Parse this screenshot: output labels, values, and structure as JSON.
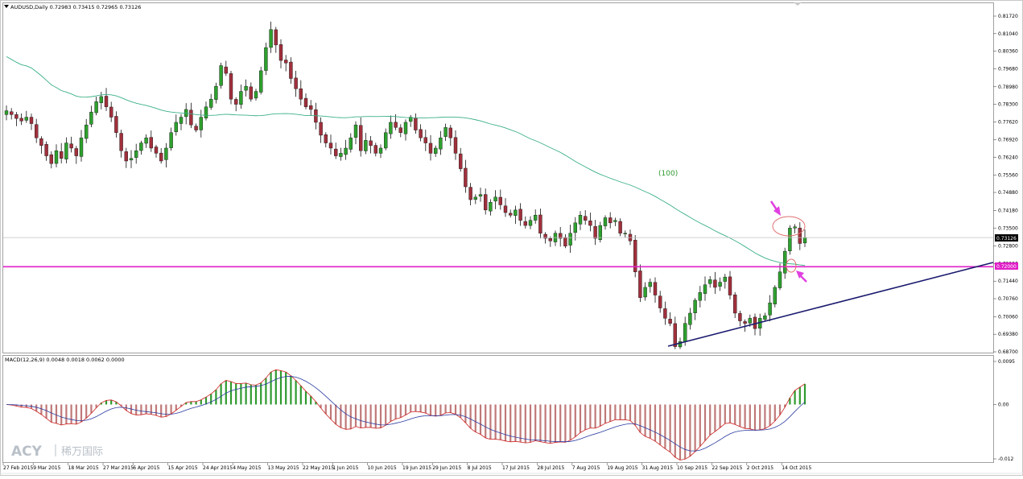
{
  "header": {
    "symbol_line": "AUDUSD,Daily  0.72983 0.73415 0.72965 0.73126",
    "indicator_line": "MACD(12,26,9) 0.0048 0.0018 0.0062 0.0000"
  },
  "labels": {
    "ma_label": "(100)",
    "price_badge": "0.73126",
    "level_badge": "0.72000"
  },
  "watermark": {
    "brand": "ACY",
    "chinese": "稀万国际"
  },
  "colors": {
    "bull": "#2ea02e",
    "bear": "#a0303c",
    "ma": "#3bb085",
    "level": "#e020c8",
    "trend": "#1a1a6e",
    "macd_pos": "#2e9a2e",
    "macd_neg": "#c07878",
    "macd_line": "#2a3aa0",
    "signal_line": "#cc2222",
    "circle": "#e07070",
    "arrow": "#e040e0"
  },
  "chart_data": [
    {
      "type": "candlestick",
      "title": "AUDUSD,Daily",
      "ylim": [
        0.687,
        0.8205
      ],
      "yticks": [
        "0.81720",
        "0.81040",
        "0.80360",
        "0.79680",
        "0.78980",
        "0.78300",
        "0.77620",
        "0.76920",
        "0.76240",
        "0.75560",
        "0.74880",
        "0.74180",
        "0.73500",
        "0.72800",
        "0.72120",
        "0.71440",
        "0.70760",
        "0.70060",
        "0.69380",
        "0.68700"
      ],
      "xticks": [
        {
          "label": "27 Feb 2015",
          "bar": 0
        },
        {
          "label": "9 Mar 2015",
          "bar": 6
        },
        {
          "label": "18 Mar 2015",
          "bar": 13
        },
        {
          "label": "27 Mar 2015",
          "bar": 20
        },
        {
          "label": "6 Apr 2015",
          "bar": 26
        },
        {
          "label": "15 Apr 2015",
          "bar": 33
        },
        {
          "label": "24 Apr 2015",
          "bar": 40
        },
        {
          "label": "4 May 2015",
          "bar": 46
        },
        {
          "label": "13 May 2015",
          "bar": 53
        },
        {
          "label": "22 May 2015",
          "bar": 60
        },
        {
          "label": "1 Jun 2015",
          "bar": 66
        },
        {
          "label": "10 Jun 2015",
          "bar": 73
        },
        {
          "label": "19 Jun 2015",
          "bar": 80
        },
        {
          "label": "29 Jun 2015",
          "bar": 86
        },
        {
          "label": "8 Jul 2015",
          "bar": 93
        },
        {
          "label": "17 Jul 2015",
          "bar": 100
        },
        {
          "label": "28 Jul 2015",
          "bar": 107
        },
        {
          "label": "7 Aug 2015",
          "bar": 114
        },
        {
          "label": "19 Aug 2015",
          "bar": 121
        },
        {
          "label": "31 Aug 2015",
          "bar": 128
        },
        {
          "label": "10 Sep 2015",
          "bar": 135
        },
        {
          "label": "22 Sep 2015",
          "bar": 142
        },
        {
          "label": "2 Oct 2015",
          "bar": 149
        },
        {
          "label": "14 Oct 2015",
          "bar": 156
        }
      ],
      "closes": [
        0.7805,
        0.779,
        0.7775,
        0.7765,
        0.778,
        0.7755,
        0.77,
        0.767,
        0.763,
        0.76,
        0.765,
        0.762,
        0.768,
        0.766,
        0.763,
        0.77,
        0.775,
        0.78,
        0.784,
        0.786,
        0.782,
        0.778,
        0.772,
        0.765,
        0.761,
        0.762,
        0.765,
        0.768,
        0.77,
        0.766,
        0.764,
        0.761,
        0.766,
        0.772,
        0.776,
        0.778,
        0.781,
        0.775,
        0.773,
        0.778,
        0.782,
        0.785,
        0.79,
        0.798,
        0.795,
        0.785,
        0.783,
        0.788,
        0.79,
        0.785,
        0.788,
        0.796,
        0.805,
        0.812,
        0.806,
        0.8,
        0.799,
        0.793,
        0.789,
        0.785,
        0.782,
        0.781,
        0.776,
        0.771,
        0.768,
        0.766,
        0.763,
        0.764,
        0.766,
        0.77,
        0.775,
        0.765,
        0.769,
        0.767,
        0.764,
        0.766,
        0.772,
        0.776,
        0.774,
        0.772,
        0.776,
        0.778,
        0.773,
        0.77,
        0.768,
        0.764,
        0.766,
        0.77,
        0.774,
        0.77,
        0.764,
        0.758,
        0.751,
        0.746,
        0.747,
        0.748,
        0.742,
        0.745,
        0.747,
        0.744,
        0.741,
        0.74,
        0.742,
        0.738,
        0.736,
        0.738,
        0.74,
        0.733,
        0.731,
        0.73,
        0.733,
        0.731,
        0.728,
        0.733,
        0.737,
        0.74,
        0.738,
        0.736,
        0.731,
        0.736,
        0.739,
        0.737,
        0.738,
        0.733,
        0.733,
        0.73,
        0.718,
        0.708,
        0.712,
        0.714,
        0.709,
        0.704,
        0.7,
        0.698,
        0.689,
        0.691,
        0.698,
        0.702,
        0.707,
        0.71,
        0.713,
        0.715,
        0.712,
        0.714,
        0.716,
        0.709,
        0.702,
        0.699,
        0.698,
        0.7,
        0.696,
        0.7,
        0.701,
        0.706,
        0.712,
        0.718,
        0.726,
        0.735,
        0.7355,
        0.729,
        0.7313
      ],
      "highs_note": "OHLC derived from closes with visible wicks"
    },
    {
      "type": "line",
      "name": "MA(100)",
      "label": "(100)"
    },
    {
      "type": "macd",
      "title": "MACD(12,26,9)",
      "ylim": [
        -0.012,
        0.0095
      ],
      "yticks": [
        "0.0095",
        "0.00",
        "-0.012"
      ]
    }
  ]
}
